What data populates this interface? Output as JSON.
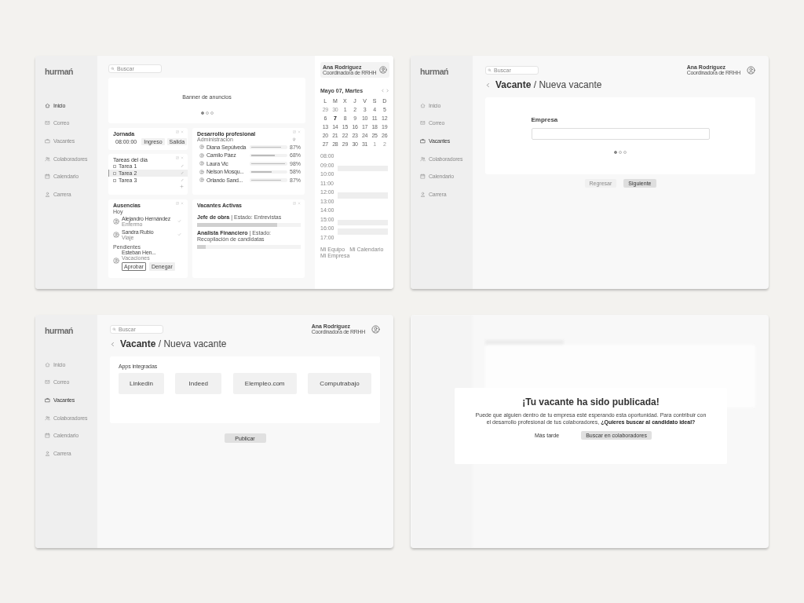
{
  "screens": [
    {
      "kind": "dashboard",
      "sidebar": {
        "logo": "hurmań",
        "items": [
          {
            "label": "Inicio",
            "selected": true
          },
          {
            "label": "Correo",
            "selected": false
          },
          {
            "label": "Vacantes",
            "selected": false
          },
          {
            "label": "Colaboradores",
            "selected": false
          },
          {
            "label": "Calendario",
            "selected": false
          },
          {
            "label": "Carrera",
            "selected": false
          }
        ]
      },
      "search": {
        "placeholder": "Buscar"
      },
      "banner": {
        "text": "Banner de anuncios",
        "pages": [
          {
            "selected": true
          },
          {
            "selected": false
          },
          {
            "selected": false
          }
        ]
      },
      "jornada": {
        "title": "Jornada",
        "time": "08:00:00",
        "buttons": [
          "Ingreso",
          "Salida"
        ]
      },
      "tasks": {
        "title": "Tareas del día",
        "items": [
          {
            "label": "Tarea 1",
            "checked": false,
            "selected": false
          },
          {
            "label": "Tarea 2",
            "checked": false,
            "selected": true
          },
          {
            "label": "Tarea 3",
            "checked": false,
            "selected": false
          }
        ]
      },
      "absences": {
        "title": "Ausencias",
        "groups": [
          {
            "label": "Hoy",
            "people": [
              {
                "name": "Alejandro Hernández",
                "note": "Enfermo",
                "kind": "approved"
              },
              {
                "name": "Sandra Rubio",
                "note": "Viaje",
                "kind": "approved"
              }
            ]
          },
          {
            "label": "Pendientes",
            "people": [
              {
                "name": "Esteban Hen...",
                "note": "Vacaciones",
                "kind": "pending",
                "actions": [
                  "Aprobar",
                  "Denegar"
                ]
              }
            ]
          }
        ]
      },
      "development": {
        "title": "Desarrollo profesional",
        "subtitle": "Administración",
        "people": [
          {
            "name": "Diana Sepúlveda",
            "level": 0.87,
            "reading": "87%"
          },
          {
            "name": "Camilo Páez",
            "level": 0.68,
            "reading": "68%"
          },
          {
            "name": "Laura Vic",
            "level": 0.98,
            "reading": "98%"
          },
          {
            "name": "Nelson Mosqu...",
            "level": 0.58,
            "reading": "58%"
          },
          {
            "name": "Orlando Sand...",
            "level": 0.87,
            "reading": "87%"
          }
        ]
      },
      "vacancies": {
        "title": "Vacantes Activas",
        "items": [
          {
            "text": "**Jefe de obra** | Estado: Entrevistas",
            "level": 0.77
          },
          {
            "text": "**Analista Financiero** | Estado: Recopilación de candidatas",
            "level": 0.08
          }
        ]
      },
      "user": {
        "name": "Ana Rodríguez",
        "role": "Coordinadora de RRHH"
      },
      "calendar": {
        "title": "Mayo 07, Martes",
        "weekdays": [
          "L",
          "M",
          "X",
          "J",
          "V",
          "S",
          "D"
        ],
        "days": [
          {
            "label": "29",
            "muted": true,
            "selected": false
          },
          {
            "label": "30",
            "muted": true,
            "selected": false
          },
          {
            "label": "1",
            "muted": false,
            "selected": false
          },
          {
            "label": "2",
            "muted": false,
            "selected": false
          },
          {
            "label": "3",
            "muted": false,
            "selected": false
          },
          {
            "label": "4",
            "muted": false,
            "selected": false
          },
          {
            "label": "5",
            "muted": false,
            "selected": false
          },
          {
            "label": "6",
            "muted": false,
            "selected": false
          },
          {
            "label": "7",
            "muted": false,
            "selected": true
          },
          {
            "label": "8",
            "muted": false,
            "selected": false
          },
          {
            "label": "9",
            "muted": false,
            "selected": false
          },
          {
            "label": "10",
            "muted": false,
            "selected": false
          },
          {
            "label": "11",
            "muted": false,
            "selected": false
          },
          {
            "label": "12",
            "muted": false,
            "selected": false
          },
          {
            "label": "13",
            "muted": false,
            "selected": false
          },
          {
            "label": "14",
            "muted": false,
            "selected": false
          },
          {
            "label": "15",
            "muted": false,
            "selected": false
          },
          {
            "label": "16",
            "muted": false,
            "selected": false
          },
          {
            "label": "17",
            "muted": false,
            "selected": false
          },
          {
            "label": "18",
            "muted": false,
            "selected": false
          },
          {
            "label": "19",
            "muted": false,
            "selected": false
          },
          {
            "label": "20",
            "muted": false,
            "selected": false
          },
          {
            "label": "21",
            "muted": false,
            "selected": false
          },
          {
            "label": "22",
            "muted": false,
            "selected": false
          },
          {
            "label": "23",
            "muted": false,
            "selected": false
          },
          {
            "label": "24",
            "muted": false,
            "selected": false
          },
          {
            "label": "25",
            "muted": false,
            "selected": false
          },
          {
            "label": "26",
            "muted": false,
            "selected": false
          },
          {
            "label": "27",
            "muted": false,
            "selected": false
          },
          {
            "label": "28",
            "muted": false,
            "selected": false
          },
          {
            "label": "29",
            "muted": false,
            "selected": false
          },
          {
            "label": "30",
            "muted": false,
            "selected": false
          },
          {
            "label": "31",
            "muted": false,
            "selected": false
          },
          {
            "label": "1",
            "muted": true,
            "selected": false
          },
          {
            "label": "2",
            "muted": true,
            "selected": false
          }
        ]
      },
      "schedule": {
        "slots": [
          {
            "time": "08:00",
            "busy": false
          },
          {
            "time": "09:00",
            "busy": true
          },
          {
            "time": "10:00",
            "busy": false
          },
          {
            "time": "11:00",
            "busy": false
          },
          {
            "time": "12:00",
            "busy": true
          },
          {
            "time": "13:00",
            "busy": false
          },
          {
            "time": "14:00",
            "busy": false
          },
          {
            "time": "15:00",
            "busy": true
          },
          {
            "time": "16:00",
            "busy": true
          },
          {
            "time": "17:00",
            "busy": false
          }
        ],
        "legend": [
          "Mi Equipo",
          "Mi Calendario",
          "Mi Empresa"
        ]
      }
    },
    {
      "kind": "form_step",
      "sidebar": {
        "logo": "hurmań",
        "items": [
          {
            "label": "Inicio",
            "selected": false
          },
          {
            "label": "Correo",
            "selected": false
          },
          {
            "label": "Vacantes",
            "selected": true
          },
          {
            "label": "Colaboradores",
            "selected": false
          },
          {
            "label": "Calendario",
            "selected": false
          },
          {
            "label": "Carrera",
            "selected": false
          }
        ]
      },
      "search": {
        "placeholder": "Buscar"
      },
      "user": {
        "name": "Ana Rodríguez",
        "role": "Coordinadora de RRHH"
      },
      "heading": "**Vacante** / Nueva vacante",
      "field": {
        "label": "Empresa"
      },
      "pages": [
        {
          "selected": true
        },
        {
          "selected": false
        },
        {
          "selected": false
        }
      ],
      "buttons": [
        {
          "label": "Regresar",
          "disabled": true
        },
        {
          "label": "Siguiente",
          "disabled": false
        }
      ]
    },
    {
      "kind": "apps",
      "sidebar": {
        "logo": "hurmań",
        "items": [
          {
            "label": "Inicio",
            "selected": false
          },
          {
            "label": "Correo",
            "selected": false
          },
          {
            "label": "Vacantes",
            "selected": true
          },
          {
            "label": "Colaboradores",
            "selected": false
          },
          {
            "label": "Calendario",
            "selected": false
          },
          {
            "label": "Carrera",
            "selected": false
          }
        ]
      },
      "search": {
        "placeholder": "Buscar"
      },
      "user": {
        "name": "Ana Rodríguez",
        "role": "Coordinadora de RRHH"
      },
      "heading": "**Vacante** / Nueva vacante",
      "apps": {
        "title": "Apps integradas",
        "items": [
          "Linkedin",
          "Indeed",
          "Elempleo.com",
          "Computrabajo"
        ]
      },
      "button": "Publicar"
    },
    {
      "kind": "modal",
      "modal": {
        "title": "¡Tu vacante ha sido publicada!",
        "text": "Puede que alguien dentro de tu empresa esté esperando esta oportunidad. Para contribuir con el desarrollo profesional de tus colaboradores, **¿Quieres buscar al candidato ideal?**",
        "buttons": [
          {
            "label": "Más tarde",
            "kind": "link"
          },
          {
            "label": "Buscar en colaboradores",
            "kind": "primary"
          }
        ]
      }
    }
  ]
}
